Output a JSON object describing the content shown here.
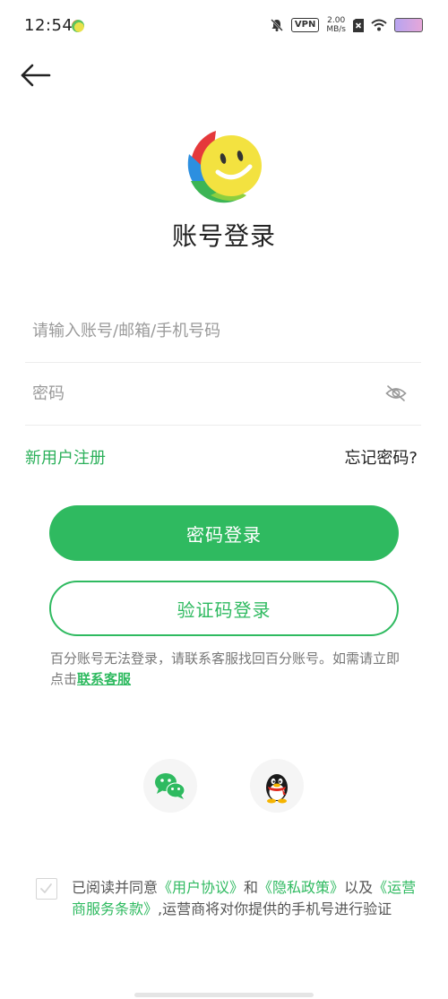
{
  "status_bar": {
    "time": "12:54",
    "vpn": "VPN",
    "net_speed_value": "2.00",
    "net_speed_unit": "MB/s"
  },
  "page": {
    "title": "账号登录"
  },
  "form": {
    "account_placeholder": "请输入账号/邮箱/手机号码",
    "account_value": "",
    "password_placeholder": "密码",
    "password_value": ""
  },
  "links": {
    "register": "新用户注册",
    "forgot": "忘记密码?"
  },
  "buttons": {
    "password_login": "密码登录",
    "code_login": "验证码登录"
  },
  "notice": {
    "text": "百分账号无法登录，请联系客服找回百分账号。如需请立即点击",
    "link": "联系客服"
  },
  "agreement": {
    "prefix": "已阅读并同意",
    "user_agreement": "《用户协议》",
    "and": "和",
    "privacy_policy": "《隐私政策》",
    "also": "以及",
    "carrier_terms": "《运营商服务条款》",
    "suffix": ",运营商将对你提供的手机号进行验证",
    "checked": false
  },
  "colors": {
    "brand_green": "#2fba60",
    "text_dark": "#222222",
    "placeholder_gray": "#9a9a9a"
  },
  "icons": {
    "back": "arrow-left-icon",
    "password_visibility": "eye-off-icon",
    "wechat": "wechat-icon",
    "qq": "qq-penguin-icon",
    "logo": "smiley-logo-icon"
  }
}
